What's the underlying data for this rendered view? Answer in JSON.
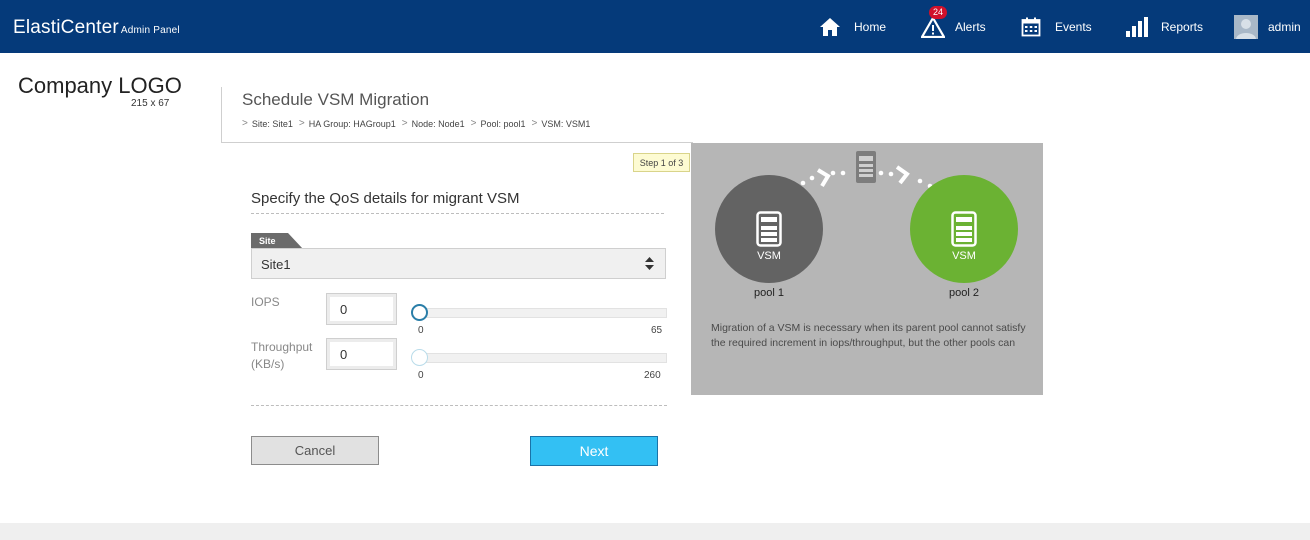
{
  "app": {
    "brand": "ElastiCenter",
    "brand_sub": "Admin Panel"
  },
  "nav": {
    "home": "Home",
    "alerts": "Alerts",
    "alerts_count": "24",
    "events": "Events",
    "reports": "Reports",
    "user": "admin"
  },
  "logo": {
    "text": "Company LOGO",
    "size": "215 x 67"
  },
  "page": {
    "title": "Schedule VSM Migration",
    "breadcrumb": [
      "Site: Site1",
      "HA Group: HAGroup1",
      "Node: Node1",
      "Pool: pool1",
      "VSM: VSM1"
    ],
    "step": "Step 1 of 3"
  },
  "form": {
    "section_title": "Specify the QoS details for migrant VSM",
    "site_tab": "Site",
    "site_value": "Site1",
    "iops_label": "IOPS",
    "iops_value": "0",
    "iops_min": "0",
    "iops_max": "65",
    "iops_slider_value": 0,
    "throughput_label_1": "Throughput",
    "throughput_label_2": "(KB/s)",
    "throughput_value": "0",
    "throughput_min": "0",
    "throughput_max": "260",
    "throughput_slider_value": 0,
    "cancel": "Cancel",
    "next": "Next"
  },
  "panel": {
    "source_vsm": "VSM",
    "source_pool": "pool 1",
    "target_vsm": "VSM",
    "target_pool": "pool 2",
    "description": "Migration of a VSM is necessary when its parent pool cannot satisfy the required increment in iops/throughput, but the other pools can"
  },
  "colors": {
    "header_bg": "#053a7a",
    "source_circle": "#636363",
    "target_circle": "#6bb233",
    "next_button": "#33c0f3",
    "slider_knob": "#2a7ea8"
  }
}
